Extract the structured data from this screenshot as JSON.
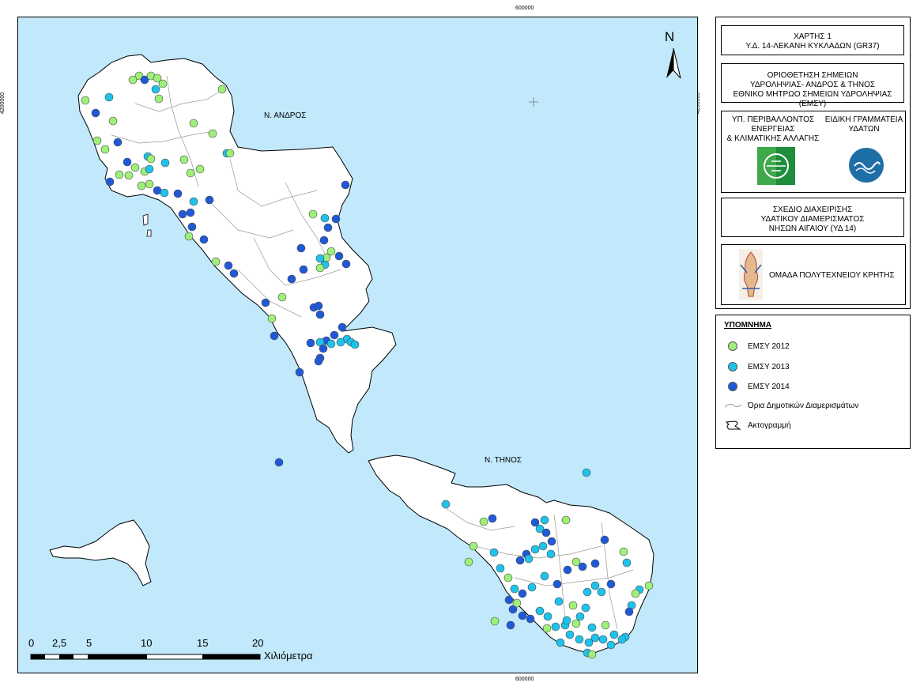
{
  "map": {
    "coord_top": "600000",
    "coord_bottom": "600000",
    "coord_left": "4200000",
    "coord_right": "4200000",
    "north_label": "N",
    "andros_label": "Ν. ΑΝΔΡΟΣ",
    "tinos_label": "Ν. ΤΗΝΟΣ",
    "colors": {
      "sea": "#c1e9fb",
      "land": "#ffffff",
      "year_2012": "#9ef07a",
      "year_2013": "#1ec3ec",
      "year_2014": "#1f59d8"
    }
  },
  "panel": {
    "title_line1": "ΧΑΡΤΗΣ 1",
    "title_line2": "Υ.Δ. 14-ΛΕΚΑΝΗ ΚΥΚΛΑΔΩΝ (GR37)",
    "subtitle_line1": "ΟΡΙΟΘΕΤΗΣΗ ΣΗΜΕΙΩΝ",
    "subtitle_line2": "ΥΔΡΟΛΗΨΙΑΣ- ΑΝΔΡΟΣ & ΤΗΝΟΣ",
    "subtitle_line3": "ΕΘΝΙΚΟ ΜΗΤΡΩΟ ΣΗΜΕΙΩΝ ΥΔΡΟΛΗΨΙΑΣ (ΕΜΣΥ)",
    "ministry_line1": "ΥΠ. ΠΕΡΙΒΑΛΛΟΝΤΟΣ",
    "ministry_line2": "ΕΝΕΡΓΕΙΑΣ",
    "ministry_line3": "& ΚΛΙΜΑΤΙΚΗΣ ΑΛΛΑΓΗΣ",
    "secretariat_line1": "ΕΙΔΙΚΗ ΓΡΑΜΜΑΤΕΙΑ",
    "secretariat_line2": "ΥΔΑΤΩΝ",
    "plan_line1": "ΣΧΕΔΙΟ ΔΙΑΧΕΙΡΙΣΗΣ",
    "plan_line2": "ΥΔΑΤΙΚΟΥ ΔΙΑΜΕΡΙΣΜΑΤΟΣ",
    "plan_line3": "ΝΗΣΩΝ ΑΙΓΑΙΟΥ (ΥΔ 14)",
    "team": "ΟΜΑΔΑ ΠΟΛΥΤΕΧΝΕΙΟΥ ΚΡΗΤΗΣ"
  },
  "legend": {
    "title": "ΥΠΟΜΝΗΜΑ",
    "items": [
      {
        "label": "ΕΜΣΥ 2012",
        "symbol": "green-point"
      },
      {
        "label": "ΕΜΣΥ 2013",
        "symbol": "cyan-point"
      },
      {
        "label": "ΕΜΣΥ 2014",
        "symbol": "blue-point"
      },
      {
        "label": "Όρια Δημοτικών Διαμερισμάτων",
        "symbol": "boundary-line"
      },
      {
        "label": "Ακτογραμμή",
        "symbol": "coastline"
      }
    ]
  },
  "scalebar": {
    "ticks": [
      "0",
      "2,5",
      "5",
      "10",
      "15",
      "20"
    ],
    "unit": "Χιλιόμετρα"
  }
}
